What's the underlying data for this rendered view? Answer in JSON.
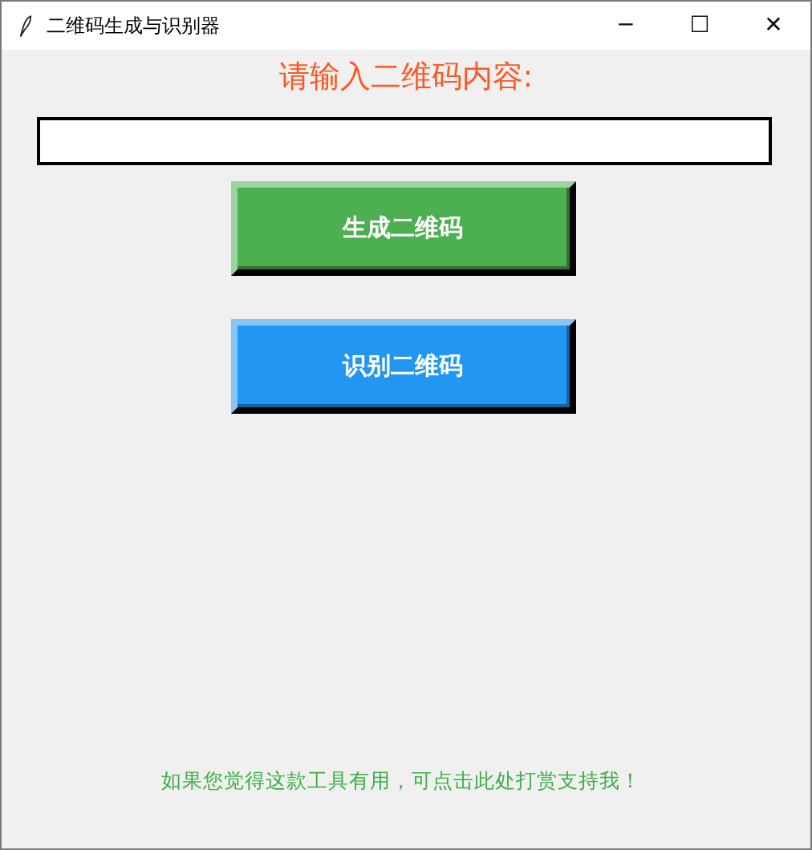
{
  "window": {
    "title": "二维码生成与识别器",
    "controls": [
      "─",
      "☐",
      "✕"
    ]
  },
  "prompt": "请输入二维码内容:",
  "buttons": [
    {
      "label": "生成二维码",
      "color": "#4caf50"
    },
    {
      "label": "识别二维码",
      "color": "#2196f3"
    }
  ],
  "footer_link": "如果您觉得这款工具有用，可点击此处打赏支持我！"
}
